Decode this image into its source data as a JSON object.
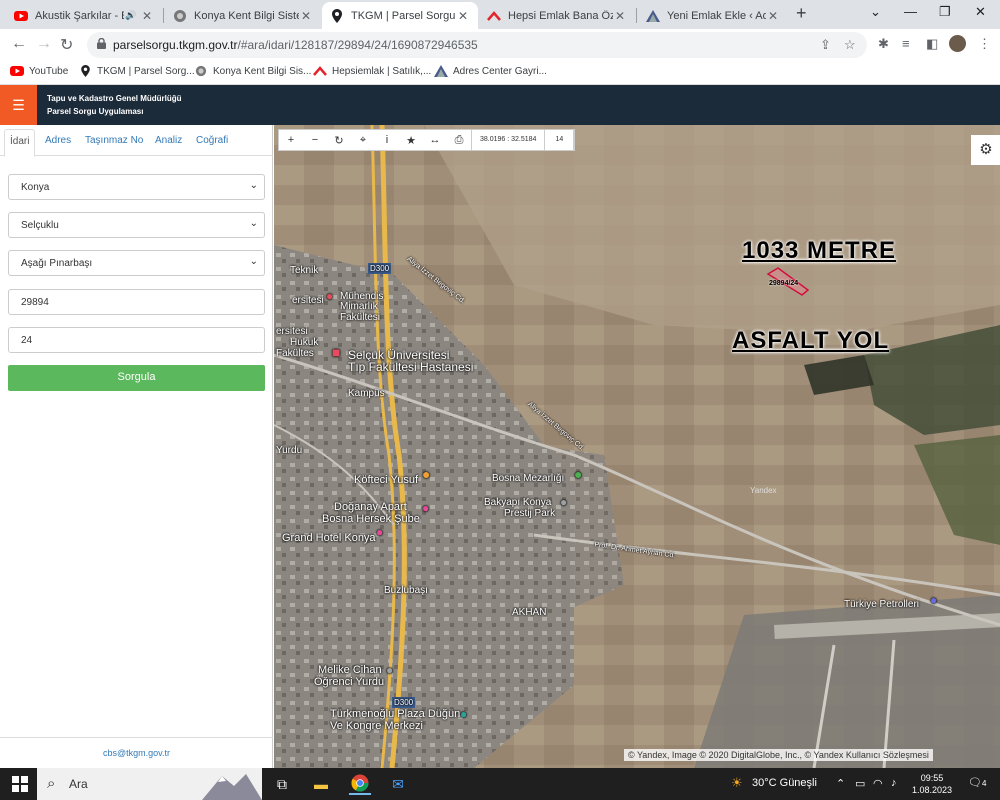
{
  "browser": {
    "tabs": [
      {
        "title": "Akustik Şarkılar - En Ç",
        "favicon": "youtube-icon"
      },
      {
        "title": "Konya Kent Bilgi Sistemi",
        "favicon": "kent-icon"
      },
      {
        "title": "TKGM | Parsel Sorgu Uygu",
        "favicon": "pin-icon",
        "active": true
      },
      {
        "title": "Hepsi Emlak Bana Özel",
        "favicon": "hepsiemlak-icon"
      },
      {
        "title": "Yeni Emlak Ekle ‹ Adres Ce",
        "favicon": "adres-icon"
      }
    ],
    "url_host": "parselsorgu.tkgm.gov.tr",
    "url_path": "/#ara/idari/128187/29894/24/1690872946535",
    "bookmarks": [
      {
        "label": "YouTube",
        "favicon": "youtube-icon"
      },
      {
        "label": "TKGM | Parsel Sorg...",
        "favicon": "pin-icon"
      },
      {
        "label": "Konya Kent Bilgi Sis...",
        "favicon": "kent-icon"
      },
      {
        "label": "Hepsiemlak | Satılık,...",
        "favicon": "hepsiemlak-icon"
      },
      {
        "label": "Adres Center Gayri...",
        "favicon": "adres-icon"
      }
    ]
  },
  "app": {
    "title_line1": "Tapu ve Kadastro Genel Müdürlüğü",
    "title_line2": "Parsel Sorgu Uygulaması"
  },
  "panel": {
    "tabs": [
      "İdari",
      "Adres",
      "Taşınmaz No",
      "Analiz",
      "Coğrafi"
    ],
    "province": "Konya",
    "district": "Selçuklu",
    "neighborhood": "Aşağı Pınarbaşı",
    "block_no": "29894",
    "parcel_no": "24",
    "query_button": "Sorgula",
    "email": "cbs@tkgm.gov.tr"
  },
  "map": {
    "coordinates": "38.0196 : 32.5184",
    "zoom": "14",
    "parcel_label": "29894/24",
    "annotation_distance": "1033 METRE",
    "annotation_road": "ASFALT YOL",
    "copyright": "© Yandex, Image © 2020 DigitalGlobe, Inc., © Yandex Kullanıcı Sözleşmesi",
    "places": {
      "teknik": "Teknik",
      "mimarlik": "Mimarlık",
      "fakultesi": "Fakültesi",
      "muhendislik": "Mühendis",
      "ersitesi": "ersitesi",
      "hukuk": "Hukuk",
      "fakultes": "Fakültes",
      "selcuk": "Selçuk Üniversitesi",
      "tip": "Tıp Fakültesi Hastanesi",
      "kampus": "Kampüs",
      "yurdu": "Yurdu",
      "kofteci": "Köfteci Yusuf",
      "doganay": "Doğanay Apart",
      "bosna": "Bosna Hersek Şube",
      "grand": "Grand Hotel Konya",
      "bosna_mezar": "Bosna Mezarlığı",
      "bakyapi": "Bakyapı Konya",
      "prestij": "Prestij Park",
      "akhan": "AKHAN",
      "buzlu": "Buzlubaşı",
      "melike": "Melike Cihan",
      "ogrenci": "Öğrenci Yurdu",
      "turkmen": "Türkmenoğlu Plaza Düğün",
      "kongre": "Ve Kongre Merkezi",
      "turkiye": "Türkiye Petrolleri",
      "d300a": "D300",
      "d300b": "D300",
      "road1": "Aliya İzzet Begoviç Cd.",
      "road2": "Aliya İzzet Begoviç Cd.",
      "road3": "Prof. Dr. Ahmet Ayhan Cd.",
      "yandex": "Yandex"
    }
  },
  "taskbar": {
    "search_placeholder": "Ara",
    "weather": "30°C  Güneşli",
    "time": "09:55",
    "date": "1.08.2023",
    "notifications": "4"
  }
}
